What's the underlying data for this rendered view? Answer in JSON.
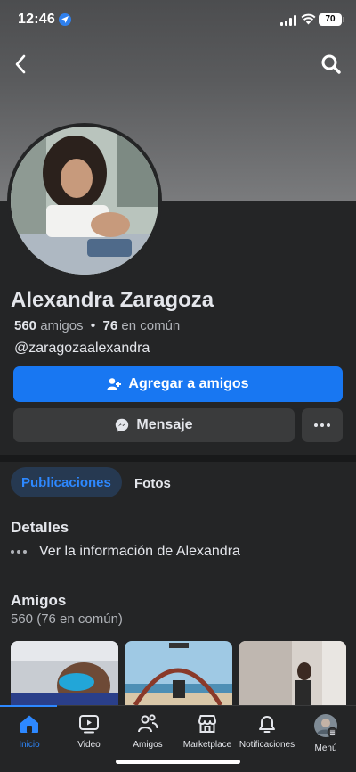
{
  "status_bar": {
    "time": "12:46",
    "battery": "70"
  },
  "profile": {
    "name": "Alexandra Zaragoza",
    "friends_count": "560",
    "friends_word": "amigos",
    "separator": "•",
    "mutual_count": "76",
    "mutual_word": "en común",
    "handle": "@zaragozaalexandra"
  },
  "actions": {
    "add_friend_label": "Agregar a amigos",
    "message_label": "Mensaje"
  },
  "tabs": [
    {
      "label": "Publicaciones",
      "active": true
    },
    {
      "label": "Fotos",
      "active": false
    }
  ],
  "details": {
    "title": "Detalles",
    "info_link": "Ver la información de Alexandra"
  },
  "friends": {
    "title": "Amigos",
    "subtitle": "560 (76 en común)"
  },
  "nav": [
    {
      "label": "Inicio",
      "icon": "home-icon",
      "active": true
    },
    {
      "label": "Video",
      "icon": "video-icon",
      "active": false
    },
    {
      "label": "Amigos",
      "icon": "friends-icon",
      "active": false
    },
    {
      "label": "Marketplace",
      "icon": "marketplace-icon",
      "active": false
    },
    {
      "label": "Notificaciones",
      "icon": "bell-icon",
      "active": false
    },
    {
      "label": "Menú",
      "icon": "menu-avatar-icon",
      "active": false
    }
  ],
  "colors": {
    "accent": "#1877f2",
    "background": "#242526",
    "button": "#3a3b3c"
  }
}
